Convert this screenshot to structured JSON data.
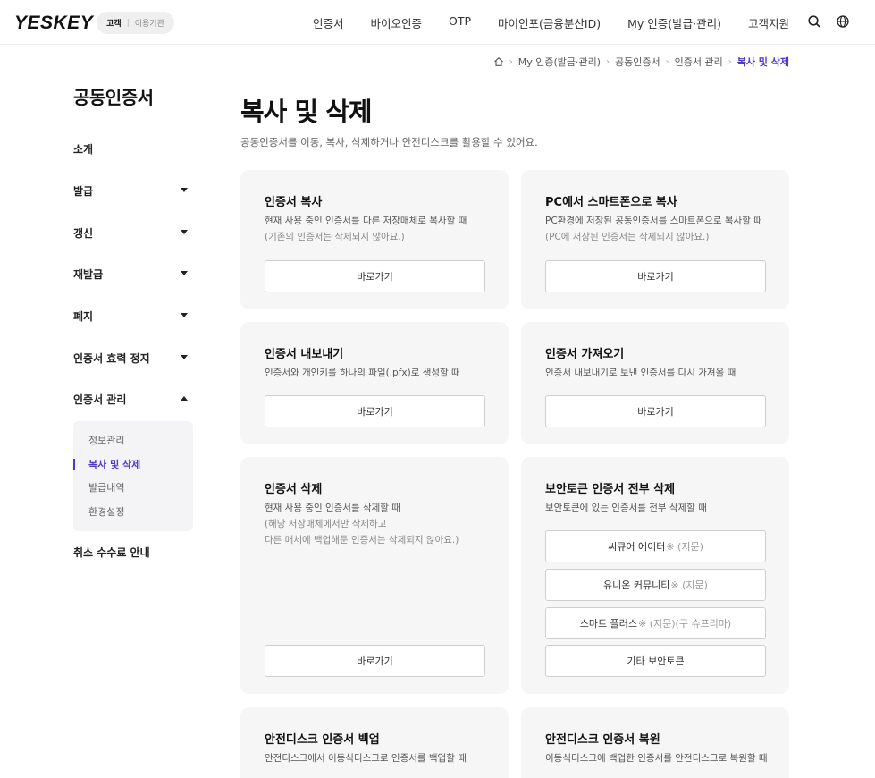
{
  "header": {
    "logo": "YESKEY",
    "usertype_on": "고객",
    "usertype_sep": "|",
    "usertype_off": "이용기관",
    "nav": [
      "인증서",
      "바이오인증",
      "OTP",
      "마이인포(금융분산ID)",
      "My 인증(발급·관리)",
      "고객지원"
    ],
    "icons": [
      "search-icon",
      "globe-icon"
    ]
  },
  "breadcrumb": {
    "items": [
      "My 인증(발급·관리)",
      "공동인증서",
      "인증서 관리"
    ],
    "current": "복사 및 삭제"
  },
  "sidebar": {
    "title": "공동인증서",
    "items": [
      {
        "label": "소개"
      },
      {
        "label": "발급"
      },
      {
        "label": "갱신"
      },
      {
        "label": "재발급"
      },
      {
        "label": "폐지"
      },
      {
        "label": "인증서 효력 정지"
      },
      {
        "label": "인증서 관리"
      },
      {
        "label": "취소 수수료 안내"
      }
    ],
    "submenu": [
      "정보관리",
      "복사 및 삭제",
      "발급내역",
      "환경설정"
    ]
  },
  "main": {
    "title": "복사 및 삭제",
    "desc": "공동인증서를 이동, 복사, 삭제하거나 안전디스크를 활용할 수 있어요.",
    "cards": {
      "copy": {
        "title": "인증서 복사",
        "desc": "현재 사용 중인 인증서를 다른 저장매체로 복사할 때",
        "note": "(기존의 인증서는 삭제되지 않아요.)",
        "button": "바로가기"
      },
      "pc_to_phone": {
        "title": "PC에서 스마트폰으로 복사",
        "desc": "PC환경에 저장된 공동인증서를 스마트폰으로 복사할 때",
        "note": "(PC에 저장된 인증서는 삭제되지 않아요.)",
        "button": "바로가기"
      },
      "export": {
        "title": "인증서 내보내기",
        "desc": "인증서와 개인키를 하나의 파일(.pfx)로 생성할 때",
        "button": "바로가기"
      },
      "import": {
        "title": "인증서 가져오기",
        "desc": "인증서 내보내기로 보낸 인증서를 다시 가져올 때",
        "button": "바로가기"
      },
      "delete": {
        "title": "인증서 삭제",
        "desc": "현재 사용 중인 인증서를 삭제할 때",
        "note1": "(해당 저장매체에서만 삭제하고",
        "note2": "다른 매체에 백업해둔 인증서는 삭제되지 않아요.)",
        "button": "바로가기"
      },
      "token_delete": {
        "title": "보안토큰 인증서 전부 삭제",
        "desc": "보안토큰에 있는 인증서를 전부 삭제할 때",
        "buttons": [
          {
            "label": "씨큐어 에이터",
            "suffix": "※ (지문)"
          },
          {
            "label": "유니온 커뮤니티",
            "suffix": "※ (지문)"
          },
          {
            "label": "스마트 플러스",
            "suffix": "※ (지문)(구 슈프리마)"
          },
          {
            "label": "기타 보안토큰",
            "suffix": ""
          }
        ]
      },
      "safedisk_backup": {
        "title": "안전디스크 인증서 백업",
        "desc": "안전디스크에서 이동식디스크로 인증서를 백업할 때"
      },
      "safedisk_restore": {
        "title": "안전디스크 인증서 복원",
        "desc": "이동식디스크에 백업한 인증서를 안전디스크로 복원할 때"
      }
    }
  },
  "colors": {
    "accent": "#4b3bc7",
    "card_bg": "#f6f6f6",
    "submenu_bg": "#f4f4f6"
  }
}
